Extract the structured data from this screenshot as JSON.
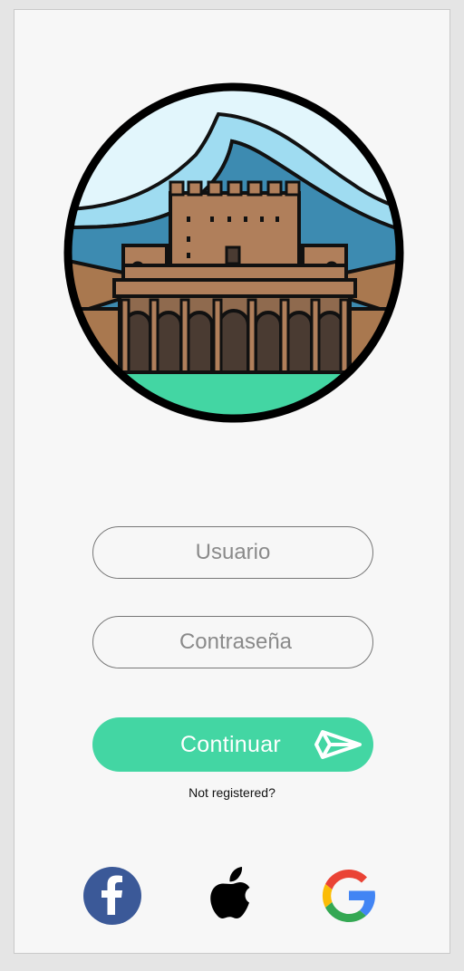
{
  "colors": {
    "accent": "#43d6a3",
    "background": "#f7f7f7",
    "facebook": "#3b5998"
  },
  "hero": {
    "icon": "alhambra-illustration"
  },
  "form": {
    "username_placeholder": "Usuario",
    "password_placeholder": "Contraseña",
    "continue_label": "Continuar",
    "continue_icon": "send-icon",
    "register_link": "Not registered?"
  },
  "social": [
    {
      "icon": "facebook-icon"
    },
    {
      "icon": "apple-icon"
    },
    {
      "icon": "google-icon"
    }
  ]
}
